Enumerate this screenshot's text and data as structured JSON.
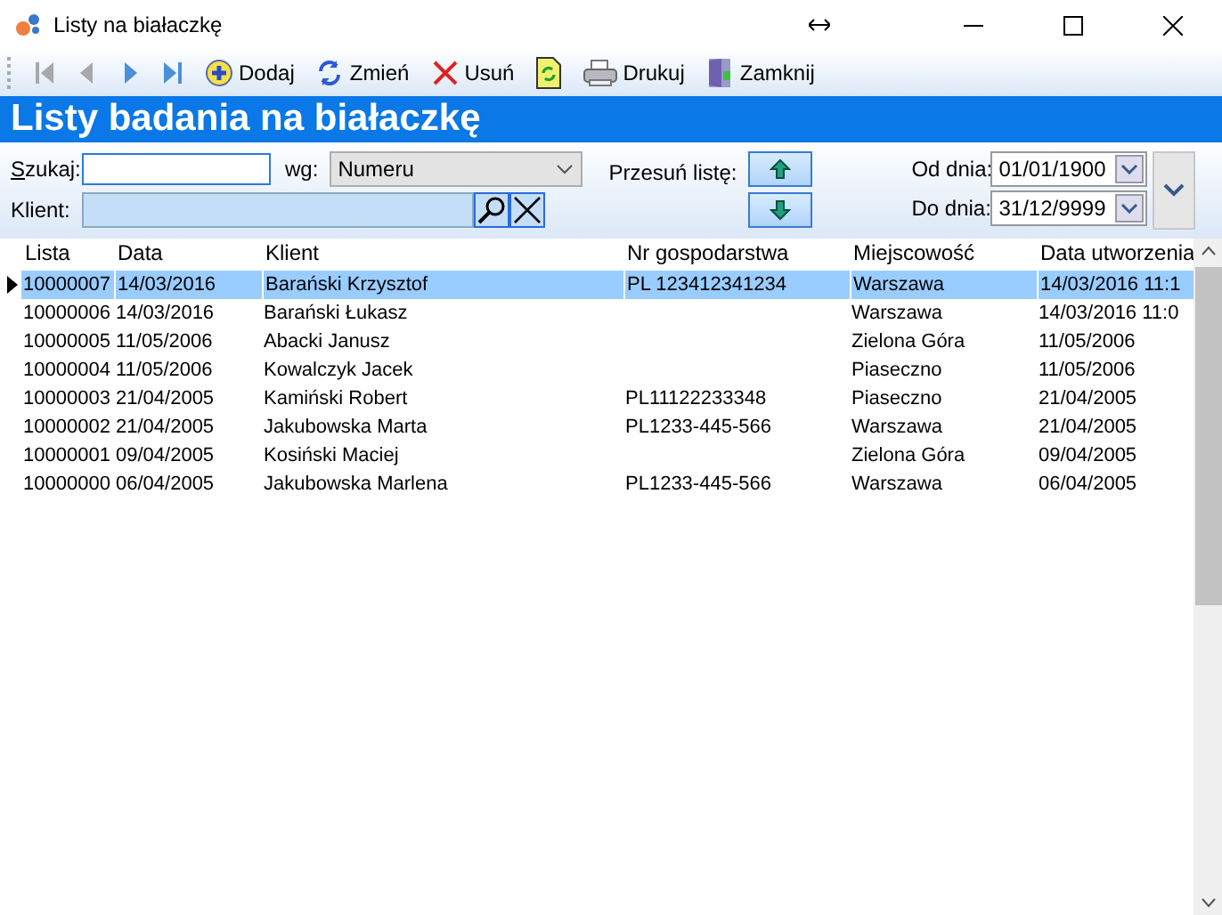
{
  "window": {
    "title": "Listy na białaczkę"
  },
  "toolbar": [
    {
      "kind": "first",
      "disabled": true
    },
    {
      "kind": "prev",
      "disabled": true
    },
    {
      "kind": "next",
      "disabled": false
    },
    {
      "kind": "last",
      "disabled": false
    },
    {
      "kind": "add",
      "label": "Dodaj"
    },
    {
      "kind": "edit",
      "label": "Zmień"
    },
    {
      "kind": "delete",
      "label": "Usuń"
    },
    {
      "kind": "refresh"
    },
    {
      "kind": "print",
      "label": "Drukuj"
    },
    {
      "kind": "close",
      "label": "Zamknij"
    }
  ],
  "header": {
    "title": "Listy badania na białaczkę"
  },
  "filters": {
    "search": {
      "access_key": "S",
      "label_rest": "zukaj:"
    },
    "by": {
      "label": "wg:",
      "value": "Numeru"
    },
    "client": {
      "label": "Klient:"
    },
    "move": {
      "label": "Przesuń listę:"
    },
    "from": {
      "label": "Od dnia:",
      "value": "01/01/1900"
    },
    "to": {
      "label": "Do dnia:",
      "value": "31/12/9999"
    }
  },
  "table": {
    "columns": [
      "Lista",
      "Data",
      "Klient",
      "Nr gospodarstwa",
      "Miejscowość",
      "Data utworzenia"
    ],
    "rows": [
      {
        "selected": true,
        "cells": [
          "10000007",
          "14/03/2016",
          "Barański Krzysztof",
          "PL 123412341234",
          "Warszawa",
          "14/03/2016 11:1"
        ]
      },
      {
        "selected": false,
        "cells": [
          "10000006",
          "14/03/2016",
          "Barański Łukasz",
          "",
          "Warszawa",
          "14/03/2016 11:0"
        ]
      },
      {
        "selected": false,
        "cells": [
          "10000005",
          "11/05/2006",
          "Abacki Janusz",
          "",
          "Zielona Góra",
          "11/05/2006"
        ]
      },
      {
        "selected": false,
        "cells": [
          "10000004",
          "11/05/2006",
          "Kowalczyk Jacek",
          "",
          "Piaseczno",
          "11/05/2006"
        ]
      },
      {
        "selected": false,
        "cells": [
          "10000003",
          "21/04/2005",
          "Kamiński Robert",
          "PL11122233348",
          "Piaseczno",
          "21/04/2005"
        ]
      },
      {
        "selected": false,
        "cells": [
          "10000002",
          "21/04/2005",
          "Jakubowska Marta",
          "PL1233-445-566",
          "Warszawa",
          "21/04/2005"
        ]
      },
      {
        "selected": false,
        "cells": [
          "10000001",
          "09/04/2005",
          "Kosiński Maciej",
          "",
          "Zielona Góra",
          "09/04/2005"
        ]
      },
      {
        "selected": false,
        "cells": [
          "10000000",
          "06/04/2005",
          "Jakubowska Marlena",
          "PL1233-445-566",
          "Warszawa",
          "06/04/2005"
        ]
      }
    ]
  }
}
